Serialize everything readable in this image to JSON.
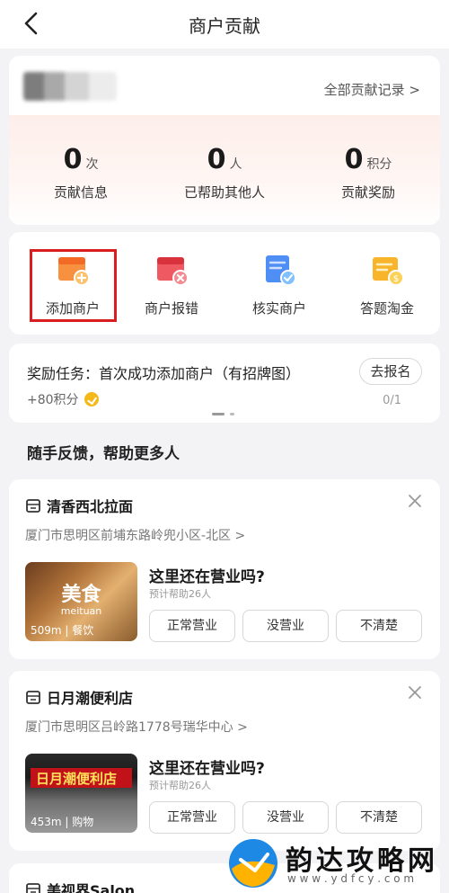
{
  "header": {
    "title": "商户贡献"
  },
  "user": {
    "all_records": "全部贡献记录 >"
  },
  "stats": [
    {
      "value": "0",
      "unit": "次",
      "label": "贡献信息"
    },
    {
      "value": "0",
      "unit": "人",
      "label": "已帮助其他人"
    },
    {
      "value": "0",
      "unit": "积分",
      "label": "贡献奖励"
    }
  ],
  "actions": [
    {
      "label": "添加商户",
      "icon": "add-shop-icon",
      "color": "#f6702c"
    },
    {
      "label": "商户报错",
      "icon": "report-shop-icon",
      "color": "#e8434b"
    },
    {
      "label": "核实商户",
      "icon": "verify-shop-icon",
      "color": "#3c7ff2"
    },
    {
      "label": "答题淘金",
      "icon": "quiz-gold-icon",
      "color": "#f6a81c"
    }
  ],
  "task": {
    "title": "奖励任务：首次成功添加商户（有招牌图）",
    "points": "+80积分",
    "button": "去报名",
    "progress": "0/1"
  },
  "section_title": "随手反馈，帮助更多人",
  "feedback": [
    {
      "name": "清香西北拉面",
      "address": "厦门市思明区前埔东路岭兜小区-北区 >",
      "thumb_title": "美食",
      "thumb_sub": "meituan",
      "thumb_tag": "509m | 餐饮",
      "question": "这里还在营业吗?",
      "estimate": "预计帮助26人",
      "options": [
        "正常营业",
        "没营业",
        "不清楚"
      ]
    },
    {
      "name": "日月潮便利店",
      "address": "厦门市思明区吕岭路1778号瑞华中心 >",
      "thumb_sign": "日月潮便利店",
      "thumb_tag": "453m | 购物",
      "question": "这里还在营业吗?",
      "estimate": "预计帮助26人",
      "options": [
        "正常营业",
        "没营业",
        "不清楚"
      ]
    },
    {
      "name": "美视界Salon"
    }
  ],
  "watermark": {
    "name": "韵达攻略网",
    "url": "w w w . y d f c y . c o m"
  }
}
